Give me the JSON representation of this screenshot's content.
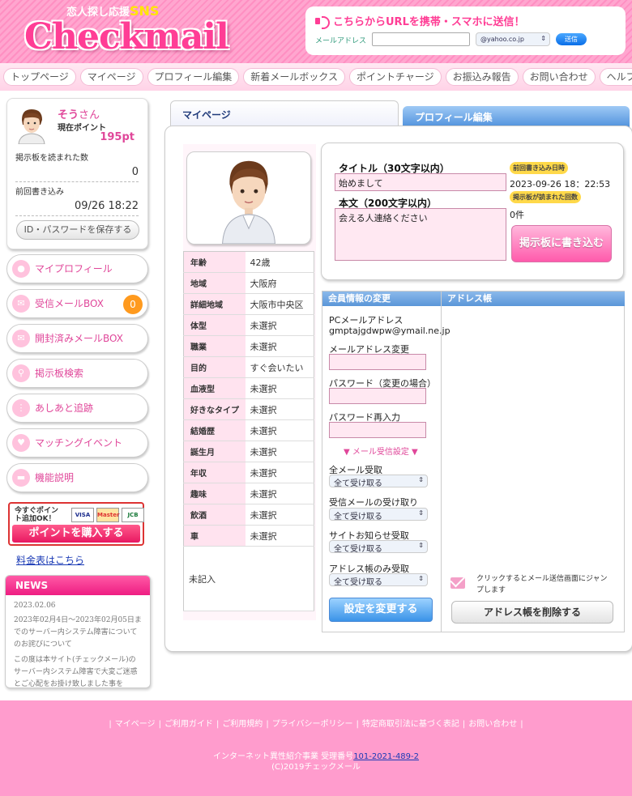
{
  "header": {
    "logo_tag": "恋人探し応援",
    "logo_tag_sns": "SNS",
    "logo_main": "Checkmail",
    "url_title": "こちらからURLを携帯・スマホに送信！",
    "email_label": "メールアドレス",
    "domain_select": "@yahoo.co.jp",
    "send_label": "送信"
  },
  "nav": [
    "トップページ",
    "マイページ",
    "プロフィール編集",
    "新着メールボックス",
    "ポイントチャージ",
    "お振込み報告",
    "お問い合わせ",
    "ヘルプ"
  ],
  "profile": {
    "name": "そう",
    "suffix": "さん",
    "points_label": "現在ポイント",
    "points": "195pt",
    "read_label": "掲示板を読まれた数",
    "read_count": "0",
    "last_label": "前回書き込み",
    "last_value": "09/26 18:22",
    "save_id": "ID・パスワードを保存する"
  },
  "side_menu": [
    {
      "label": "マイプロフィール",
      "icon": "person-icon"
    },
    {
      "label": "受信メールBOX",
      "icon": "mail-icon",
      "badge": "0"
    },
    {
      "label": "開封済みメールBOX",
      "icon": "open-mail-icon"
    },
    {
      "label": "掲示板検索",
      "icon": "search-icon"
    },
    {
      "label": "あしあと追跡",
      "icon": "footprint-icon"
    },
    {
      "label": "マッチングイベント",
      "icon": "heart-icon"
    },
    {
      "label": "機能説明",
      "icon": "chat-icon"
    }
  ],
  "buy": {
    "sub": "今すぐポイント追加OK！",
    "cards": [
      "VISA",
      "Master",
      "JCB"
    ],
    "main": "ポイントを購入する"
  },
  "fee_link": "料金表はこちら",
  "news": {
    "title": "NEWS",
    "date": "2023.02.06",
    "text": "2023年02月4日～2023年02月05日までのサーバー内システム障害についてのお詫びについて",
    "body": "この度は本サイト(チェックメール)のサーバー内システム障害で大変ご迷惑とご心配をお掛け致しました事を"
  },
  "tabs": {
    "mypage": "マイページ",
    "profile_edit": "プロフィール編集"
  },
  "profile_table": [
    [
      "年齢",
      "42歳"
    ],
    [
      "地域",
      "大阪府"
    ],
    [
      "詳細地域",
      "大阪市中央区"
    ],
    [
      "体型",
      "未選択"
    ],
    [
      "職業",
      "未選択"
    ],
    [
      "目的",
      "すぐ会いたい"
    ],
    [
      "血液型",
      "未選択"
    ],
    [
      "好きなタイプ",
      "未選択"
    ],
    [
      "結婚歴",
      "未選択"
    ],
    [
      "誕生月",
      "未選択"
    ],
    [
      "年収",
      "未選択"
    ],
    [
      "趣味",
      "未選択"
    ],
    [
      "飲酒",
      "未選択"
    ],
    [
      "車",
      "未選択"
    ]
  ],
  "memo": "未記入",
  "post": {
    "title_label": "タイトル（30文字以内）",
    "title_value": "始めまして",
    "body_label": "本文（200文字以内）",
    "body_value": "会える人連絡ください",
    "last_label": "前回書き込み日時",
    "last_value": "2023-09-26 18：22:53",
    "read_label": "掲示板が読まれた回数",
    "read_value": "0件",
    "submit": "掲示板に書き込む"
  },
  "member": {
    "header": "会員情報の変更",
    "pc_label": "PCメールアドレス",
    "pc_value": "gmptajgdwpw@ymail.ne.jp",
    "mail_change": "メールアドレス変更",
    "pw_label": "パスワード（変更の場合）",
    "pw_again": "パスワード再入力",
    "mail_setting": "▼ メール受信設定 ▼",
    "all_label": "全メール受取",
    "all_value": "全て受け取る",
    "recv_label": "受信メールの受け取り",
    "recv_value": "全て受け取る",
    "site_label": "サイトお知らせ受取",
    "site_value": "全て受け取る",
    "addr_label": "アドレス帳のみ受取",
    "addr_value": "全て受け取る",
    "submit": "設定を変更する"
  },
  "address": {
    "header": "アドレス帳",
    "jump_text": "クリックするとメール送信画面にジャンプします",
    "delete": "アドレス帳を削除する"
  },
  "footer": {
    "links": [
      "マイページ",
      "ご利用ガイド",
      "ご利用規約",
      "プライバシーポリシー",
      "特定商取引法に基づく表記",
      "お問い合わせ"
    ],
    "reg_text": "インターネット異性紹介事業 受理番号",
    "reg_no": "101-2021-489-2",
    "copyright": "(C)2019チェックメール"
  },
  "colors": {
    "brand_pink": "#ff3d95",
    "accent_blue": "#5a96d8",
    "badge_orange": "#ff9a1e"
  }
}
